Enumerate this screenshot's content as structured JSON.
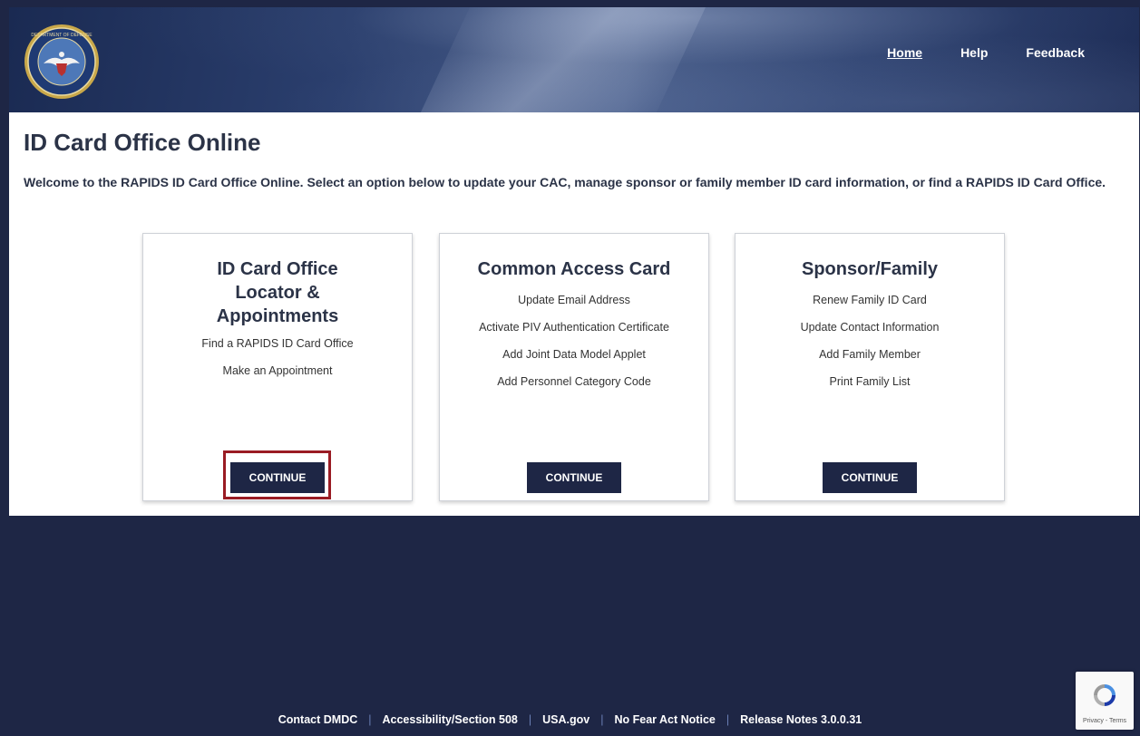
{
  "header": {
    "seal_alt": "Department of Defense seal",
    "nav": [
      {
        "label": "Home",
        "active": true
      },
      {
        "label": "Help",
        "active": false
      },
      {
        "label": "Feedback",
        "active": false
      }
    ]
  },
  "main": {
    "title": "ID Card Office Online",
    "welcome": "Welcome to the RAPIDS ID Card Office Online. Select an option below to update your CAC, manage sponsor or family member ID card information, or find a RAPIDS ID Card Office.",
    "cards": [
      {
        "title": "ID Card Office Locator & Appointments",
        "links": [
          "Find a RAPIDS ID Card Office",
          "Make an Appointment"
        ],
        "button": "CONTINUE"
      },
      {
        "title": "Common Access Card",
        "links": [
          "Update Email Address",
          "Activate PIV Authentication Certificate",
          "Add Joint Data Model Applet",
          "Add Personnel Category Code"
        ],
        "button": "CONTINUE"
      },
      {
        "title": "Sponsor/Family",
        "links": [
          "Renew Family ID Card",
          "Update Contact Information",
          "Add Family Member",
          "Print Family List"
        ],
        "button": "CONTINUE"
      }
    ]
  },
  "footer": {
    "links": [
      "Contact DMDC",
      "Accessibility/Section 508",
      "USA.gov",
      "No Fear Act Notice",
      "Release Notes 3.0.0.31"
    ],
    "separator": "|"
  },
  "recaptcha": {
    "text": "Privacy - Terms"
  },
  "colors": {
    "navy": "#1e2645",
    "highlight": "#9a1c24",
    "text": "#2b3347"
  }
}
